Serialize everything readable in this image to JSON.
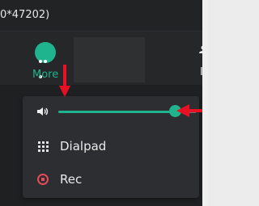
{
  "window": {
    "title": "0*47202)"
  },
  "toolbar": {
    "more_label": "More",
    "user_label": "In"
  },
  "menu": {
    "volume_level": 0.85,
    "items": [
      {
        "label": "Dialpad",
        "icon": "dialpad-icon"
      },
      {
        "label": "Rec",
        "icon": "record-icon"
      }
    ]
  },
  "colors": {
    "accent": "#1fb38e",
    "record": "#e24b57",
    "annotation_arrow": "#e81123"
  }
}
